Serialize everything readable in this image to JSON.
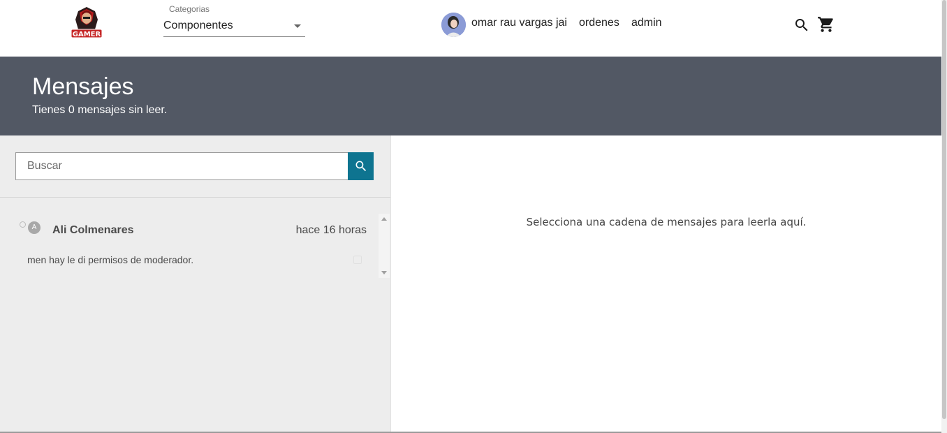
{
  "header": {
    "category_label": "Categorias",
    "category_value": "Componentes",
    "user_name": "omar rau vargas jai",
    "nav_ordenes": "ordenes",
    "nav_admin": "admin",
    "logo_text": "GAMER"
  },
  "banner": {
    "title": "Mensajes",
    "subtitle": "Tienes 0 mensajes sin leer."
  },
  "search": {
    "placeholder": "Buscar",
    "value": ""
  },
  "threads": [
    {
      "avatar_letter": "A",
      "name": "Ali Colmenares",
      "time": "hace 16 horas",
      "preview": "men hay le di permisos de moderador."
    }
  ],
  "main": {
    "empty_message": "Selecciona una cadena de mensajes para leerla aquí."
  },
  "colors": {
    "banner_bg": "#525864",
    "search_button": "#0e7490",
    "left_panel_bg": "#ededed"
  },
  "icons": {
    "top_search": "search-icon",
    "cart": "cart-icon",
    "search_button": "search-icon"
  }
}
